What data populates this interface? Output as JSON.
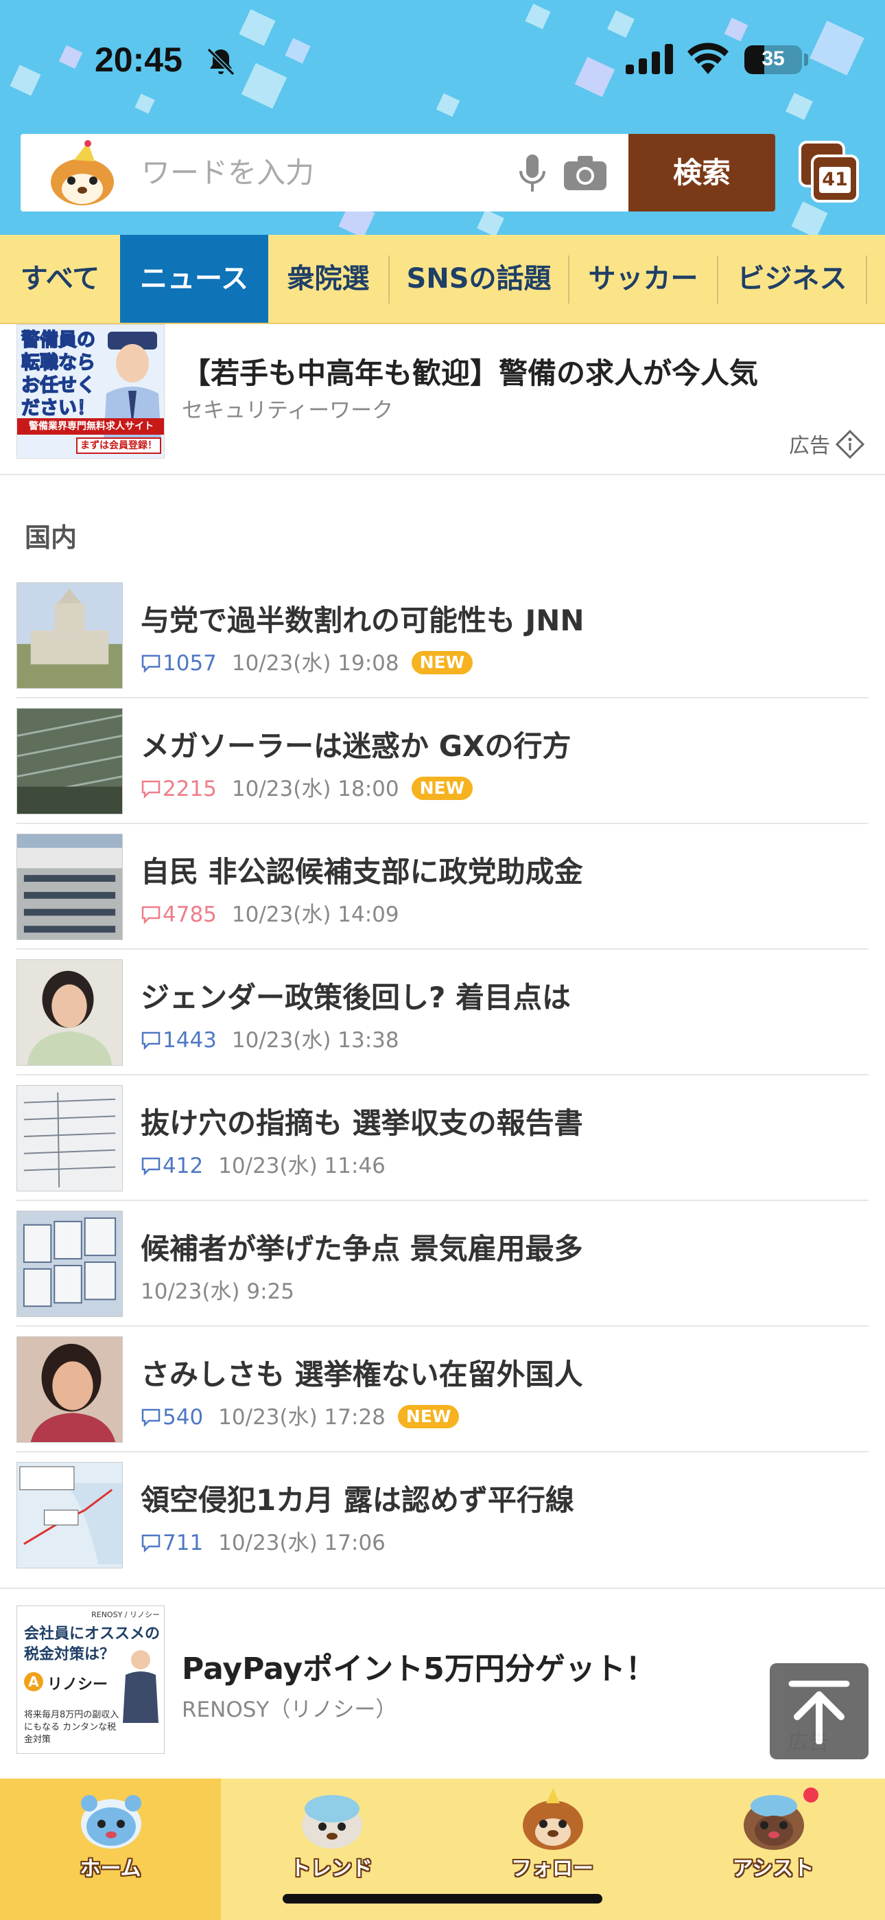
{
  "status_bar": {
    "time": "20:45",
    "battery_percent": 35,
    "battery_label": "35",
    "icons": [
      "bell-slash-icon",
      "cellular-signal-icon",
      "wifi-icon",
      "battery-icon"
    ]
  },
  "search": {
    "placeholder": "ワードを入力",
    "value": "",
    "button_label": "検索",
    "tab_count": "41"
  },
  "categories": [
    {
      "label": "すべて",
      "active": false
    },
    {
      "label": "ニュース",
      "active": true
    },
    {
      "label": "衆院選",
      "active": false
    },
    {
      "label": "SNSの話題",
      "active": false
    },
    {
      "label": "サッカー",
      "active": false
    },
    {
      "label": "ビジネス",
      "active": false
    }
  ],
  "ad_top": {
    "title": "【若手も中高年も歓迎】警備の求人が今人気",
    "sponsor": "セキュリティーワーク",
    "label": "広告",
    "thumb_text": "警備員の転職ならお任せください！",
    "thumb_strip": "警備業界専門無料求人サイト",
    "thumb_badge": "まずは会員登録！"
  },
  "section": {
    "title": "国内"
  },
  "news": [
    {
      "title": "与党で過半数割れの可能性も JNN",
      "comments": "1057",
      "hot": false,
      "date": "10/23(水) 19:08",
      "new": true
    },
    {
      "title": "メガソーラーは迷惑か GXの行方",
      "comments": "2215",
      "hot": true,
      "date": "10/23(水) 18:00",
      "new": true
    },
    {
      "title": "自民 非公認候補支部に政党助成金",
      "comments": "4785",
      "hot": true,
      "date": "10/23(水) 14:09",
      "new": false
    },
    {
      "title": "ジェンダー政策後回し? 着目点は",
      "comments": "1443",
      "hot": false,
      "date": "10/23(水) 13:38",
      "new": false
    },
    {
      "title": "抜け穴の指摘も 選挙収支の報告書",
      "comments": "412",
      "hot": false,
      "date": "10/23(水) 11:46",
      "new": false
    },
    {
      "title": "候補者が挙げた争点 景気雇用最多",
      "comments": "",
      "hot": false,
      "date": "10/23(水) 9:25",
      "new": false
    },
    {
      "title": "さみしさも 選挙権ない在留外国人",
      "comments": "540",
      "hot": false,
      "date": "10/23(水) 17:28",
      "new": true
    },
    {
      "title": "領空侵犯1カ月 露は認めず平行線",
      "comments": "711",
      "hot": false,
      "date": "10/23(水) 17:06",
      "new": false
    }
  ],
  "new_badge_label": "NEW",
  "ad_bottom": {
    "title": "PayPayポイント5万円分ゲット！",
    "sponsor": "RENOSY（リノシー）",
    "label": "広告",
    "thumb_brand": "RENOSY / リノシー",
    "thumb_line1": "会社員にオススメの",
    "thumb_line2": "税金対策は？",
    "thumb_logo": "リノシー",
    "thumb_sub": "将来毎月8万円の副収入にもなる カンタンな税金対策"
  },
  "bottom_nav": [
    {
      "label": "ホーム",
      "active": true,
      "icon": "home-mascot-icon"
    },
    {
      "label": "トレンド",
      "active": false,
      "icon": "trend-mascot-icon"
    },
    {
      "label": "フォロー",
      "active": false,
      "icon": "follow-mascot-icon"
    },
    {
      "label": "アシスト",
      "active": false,
      "icon": "assist-mascot-icon",
      "notification": true
    }
  ],
  "colors": {
    "header_bg": "#5cc6ee",
    "search_button": "#7b3a17",
    "category_bar": "#fbe488",
    "active_tab": "#0f73b8",
    "comment_blue": "#4f78c4",
    "comment_hot": "#ee7d88",
    "new_badge": "#f6b21f"
  }
}
